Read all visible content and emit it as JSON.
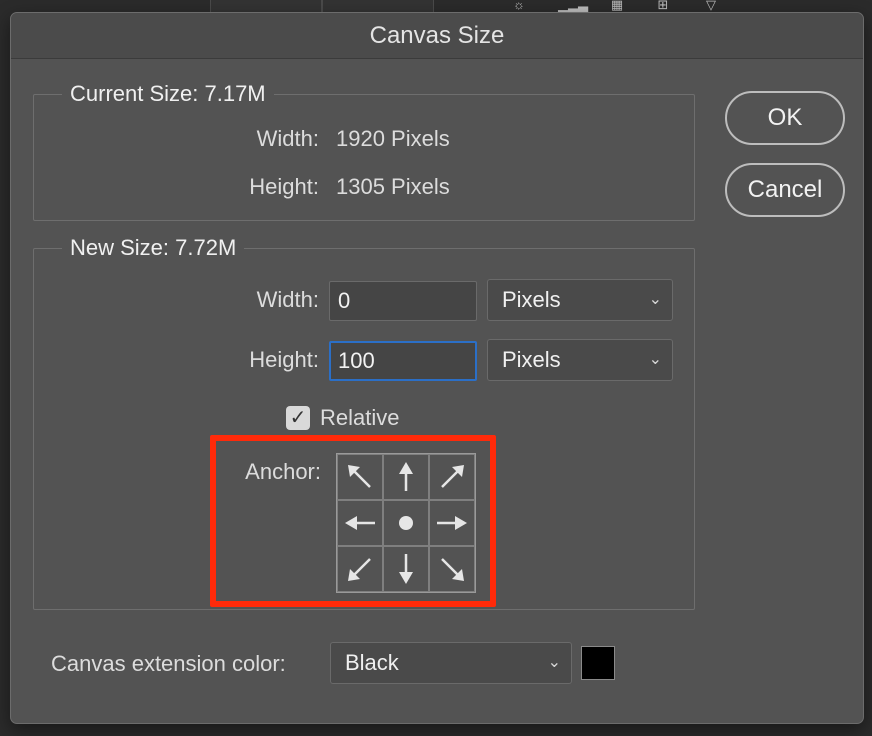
{
  "dialog": {
    "title": "Canvas Size",
    "ok_label": "OK",
    "cancel_label": "Cancel"
  },
  "current_size": {
    "legend": "Current Size: 7.17M",
    "width_label": "Width:",
    "width_value": "1920 Pixels",
    "height_label": "Height:",
    "height_value": "1305 Pixels"
  },
  "new_size": {
    "legend": "New Size: 7.72M",
    "width_label": "Width:",
    "width_value": "0",
    "width_unit": "Pixels",
    "height_label": "Height:",
    "height_value": "100",
    "height_unit": "Pixels",
    "relative_label": "Relative",
    "relative_checked": true,
    "anchor_label": "Anchor:",
    "anchor_icons": [
      "arrow-up-left-icon",
      "arrow-up-icon",
      "arrow-up-right-icon",
      "arrow-left-icon",
      "center-dot-icon",
      "arrow-right-icon",
      "arrow-down-left-icon",
      "arrow-down-icon",
      "arrow-down-right-icon"
    ]
  },
  "extension": {
    "label": "Canvas extension color:",
    "value": "Black",
    "swatch_color": "#000000"
  },
  "colors": {
    "highlight": "#ff2a0a",
    "focus": "#2b6fc7"
  }
}
